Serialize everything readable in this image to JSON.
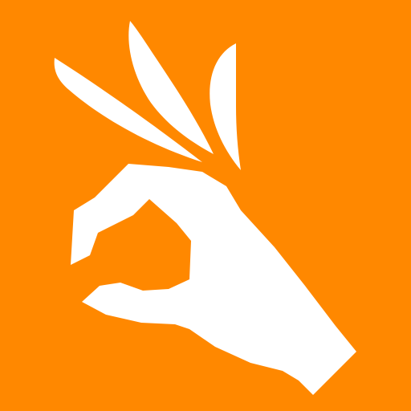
{
  "icon": {
    "name": "ok-hand-gesture-icon",
    "background_color": "#ff8800",
    "glyph_color": "#ffffff"
  }
}
